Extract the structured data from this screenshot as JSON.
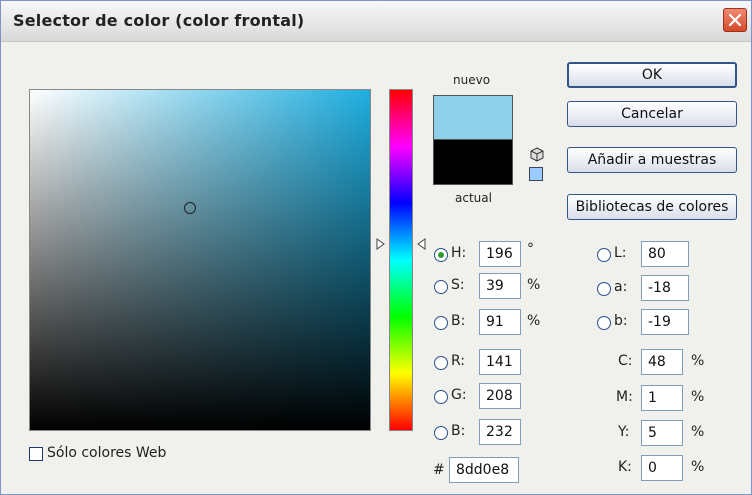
{
  "window": {
    "title": "Selector de color (color frontal)"
  },
  "preview": {
    "new_label": "nuevo",
    "current_label": "actual",
    "new_color": "#8dd0e8",
    "current_color": "#000000"
  },
  "buttons": {
    "ok": "OK",
    "cancel": "Cancelar",
    "add_swatches": "Añadir a muestras",
    "libraries": "Bibliotecas de colores"
  },
  "hsb": {
    "h": {
      "label": "H:",
      "value": "196",
      "unit": "°"
    },
    "s": {
      "label": "S:",
      "value": "39",
      "unit": "%"
    },
    "b": {
      "label": "B:",
      "value": "91",
      "unit": "%"
    }
  },
  "rgb": {
    "r": {
      "label": "R:",
      "value": "141"
    },
    "g": {
      "label": "G:",
      "value": "208"
    },
    "b": {
      "label": "B:",
      "value": "232"
    }
  },
  "lab": {
    "l": {
      "label": "L:",
      "value": "80"
    },
    "a": {
      "label": "a:",
      "value": "-18"
    },
    "b": {
      "label": "b:",
      "value": "-19"
    }
  },
  "cmyk": {
    "c": {
      "label": "C:",
      "value": "48",
      "unit": "%"
    },
    "m": {
      "label": "M:",
      "value": "1",
      "unit": "%"
    },
    "y": {
      "label": "Y:",
      "value": "5",
      "unit": "%"
    },
    "k": {
      "label": "K:",
      "value": "0",
      "unit": "%"
    }
  },
  "hex": {
    "label": "#",
    "value": "8dd0e8"
  },
  "web_only": {
    "label": "Sólo colores Web",
    "checked": false
  },
  "colors": {
    "hue_base": "#1eaee0",
    "websafe_swatch": "#99ccff"
  },
  "icons": {
    "close": "close-icon",
    "gamut_warning": "cube-icon",
    "websafe": "websafe-swatch-icon"
  }
}
